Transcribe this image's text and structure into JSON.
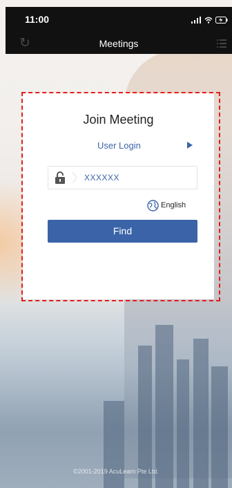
{
  "status_bar": {
    "time": "11:00",
    "icons": "signal-icon wifi-icon battery-icon"
  },
  "nav": {
    "title": "Meetings",
    "left_icon": "refresh-icon",
    "right_icon": "menu-icon"
  },
  "card": {
    "title": "Join Meeting",
    "user_login_label": "User Login",
    "meeting_id_value": "XXXXXX",
    "language_label": "English",
    "find_label": "Find"
  },
  "footer": {
    "copyright": "©2001-2019 AcuLearn Pte Ltd."
  },
  "colors": {
    "accent": "#3b64a8",
    "highlight_border": "#e41c1c",
    "bar_bg": "#111111"
  }
}
